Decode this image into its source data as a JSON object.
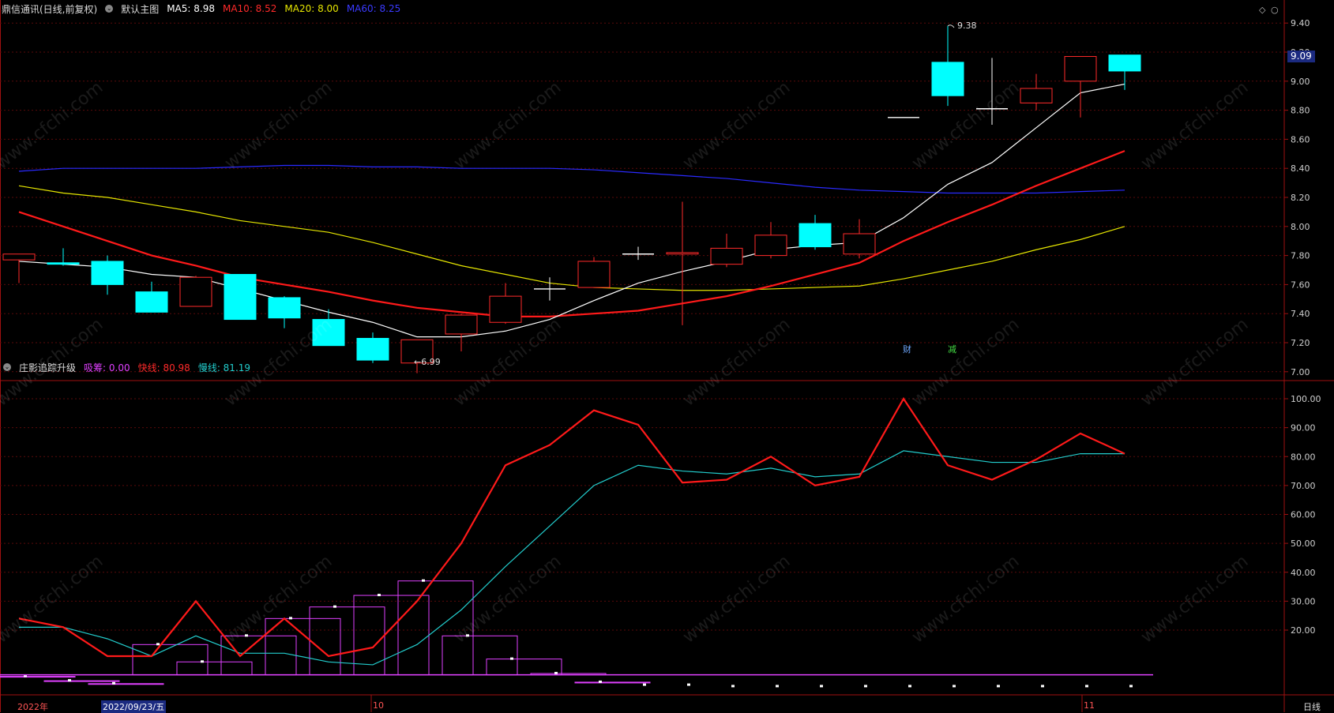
{
  "header_main": {
    "stock": "鼎信通讯(日线,前复权)",
    "chart_name": "默认主图",
    "ma5_label": "MA5: 8.98",
    "ma10_label": "MA10: 8.52",
    "ma20_label": "MA20: 8.00",
    "ma60_label": "MA60: 8.25"
  },
  "header_sub": {
    "indicator": "庄影追踪升级",
    "xichou_label": "吸筹: 0.00",
    "fast_label": "快线: 80.98",
    "slow_label": "慢线: 81.19"
  },
  "price_tag": "9.09",
  "annotations": {
    "high": "9.38",
    "low": "6.99",
    "low_arrow": "←6.99"
  },
  "events": {
    "cai": "财",
    "jian": "减"
  },
  "x_labels": {
    "year": "2022年",
    "date": "2022/09/23/五",
    "oct": "10",
    "nov": "11",
    "period": "日线"
  },
  "watermark": "www.cfchi.com",
  "colors": {
    "up": "#ff2a2a",
    "down": "#00ffff",
    "ma5": "#ffffff",
    "ma10": "#ff1a1a",
    "ma20": "#e6e600",
    "ma60": "#2a2aff",
    "fast": "#ff1a1a",
    "slow": "#22cccc",
    "xichou": "#e040ff"
  },
  "chart_data": [
    {
      "type": "candlestick",
      "title": "鼎信通讯(日线,前复权)",
      "y_ticks": [
        "9.40",
        "9.20",
        "9.00",
        "8.80",
        "8.60",
        "8.40",
        "8.20",
        "8.00",
        "7.80",
        "7.60",
        "7.40",
        "7.20",
        "7.00"
      ],
      "ylim": [
        6.95,
        9.45
      ],
      "candles": [
        {
          "o": 7.77,
          "c": 7.81,
          "h": 7.81,
          "l": 7.61
        },
        {
          "o": 7.75,
          "c": 7.74,
          "h": 7.85,
          "l": 7.73
        },
        {
          "o": 7.76,
          "c": 7.6,
          "h": 7.8,
          "l": 7.53
        },
        {
          "o": 7.55,
          "c": 7.41,
          "h": 7.62,
          "l": 7.41
        },
        {
          "o": 7.45,
          "c": 7.65,
          "h": 7.66,
          "l": 7.45
        },
        {
          "o": 7.67,
          "c": 7.36,
          "h": 7.67,
          "l": 7.36
        },
        {
          "o": 7.51,
          "c": 7.37,
          "h": 7.52,
          "l": 7.3
        },
        {
          "o": 7.36,
          "c": 7.18,
          "h": 7.43,
          "l": 7.18
        },
        {
          "o": 7.23,
          "c": 7.08,
          "h": 7.27,
          "l": 7.06
        },
        {
          "o": 7.06,
          "c": 7.22,
          "h": 7.22,
          "l": 6.99
        },
        {
          "o": 7.26,
          "c": 7.39,
          "h": 7.4,
          "l": 7.14
        },
        {
          "o": 7.34,
          "c": 7.52,
          "h": 7.61,
          "l": 7.33
        },
        {
          "o": 7.57,
          "c": 7.57,
          "h": 7.65,
          "l": 7.49
        },
        {
          "o": 7.58,
          "c": 7.76,
          "h": 7.79,
          "l": 7.58
        },
        {
          "o": 7.81,
          "c": 7.81,
          "h": 7.86,
          "l": 7.77
        },
        {
          "o": 7.81,
          "c": 7.82,
          "h": 8.17,
          "l": 7.32
        },
        {
          "o": 7.74,
          "c": 7.85,
          "h": 7.95,
          "l": 7.72
        },
        {
          "o": 7.8,
          "c": 7.94,
          "h": 8.03,
          "l": 7.78
        },
        {
          "o": 8.02,
          "c": 7.86,
          "h": 8.08,
          "l": 7.84
        },
        {
          "o": 7.81,
          "c": 7.95,
          "h": 8.05,
          "l": 7.78
        },
        {
          "o": 8.75,
          "c": 8.75,
          "h": 8.75,
          "l": 8.75
        },
        {
          "o": 9.13,
          "c": 8.9,
          "h": 9.38,
          "l": 8.83
        },
        {
          "o": 8.81,
          "c": 8.81,
          "h": 9.16,
          "l": 8.7
        },
        {
          "o": 8.85,
          "c": 8.95,
          "h": 9.05,
          "l": 8.8
        },
        {
          "o": 9.0,
          "c": 9.17,
          "h": 9.17,
          "l": 8.75
        },
        {
          "o": 9.18,
          "c": 9.07,
          "h": 9.18,
          "l": 8.94
        }
      ],
      "series": [
        {
          "name": "MA5",
          "values": [
            7.76,
            7.74,
            7.72,
            7.67,
            7.65,
            7.57,
            7.49,
            7.41,
            7.34,
            7.24,
            7.24,
            7.28,
            7.36,
            7.49,
            7.61,
            7.69,
            7.76,
            7.84,
            7.87,
            7.89,
            8.06,
            8.29,
            8.44,
            8.68,
            8.92,
            8.98
          ]
        },
        {
          "name": "MA10",
          "values": [
            8.1,
            8.0,
            7.9,
            7.8,
            7.73,
            7.65,
            7.6,
            7.55,
            7.49,
            7.44,
            7.41,
            7.38,
            7.38,
            7.4,
            7.42,
            7.47,
            7.52,
            7.59,
            7.67,
            7.75,
            7.9,
            8.03,
            8.15,
            8.28,
            8.4,
            8.52
          ]
        },
        {
          "name": "MA20",
          "values": [
            8.28,
            8.23,
            8.2,
            8.15,
            8.1,
            8.04,
            8.0,
            7.96,
            7.89,
            7.81,
            7.73,
            7.67,
            7.61,
            7.58,
            7.57,
            7.56,
            7.56,
            7.57,
            7.58,
            7.59,
            7.64,
            7.7,
            7.76,
            7.84,
            7.91,
            8.0
          ]
        },
        {
          "name": "MA60",
          "values": [
            8.38,
            8.4,
            8.4,
            8.4,
            8.4,
            8.41,
            8.42,
            8.42,
            8.41,
            8.41,
            8.4,
            8.4,
            8.4,
            8.39,
            8.37,
            8.35,
            8.33,
            8.3,
            8.27,
            8.25,
            8.24,
            8.23,
            8.23,
            8.23,
            8.24,
            8.25
          ]
        }
      ]
    },
    {
      "type": "line",
      "title": "庄影追踪升级",
      "y_ticks": [
        "100.00",
        "90.00",
        "80.00",
        "70.00",
        "60.00",
        "50.00",
        "40.00",
        "30.00",
        "20.00"
      ],
      "ylim": [
        10,
        100
      ],
      "series": [
        {
          "name": "快线",
          "values": [
            24,
            21,
            11,
            11,
            30,
            11,
            24,
            11,
            14,
            30,
            50,
            77,
            84,
            96,
            91,
            71,
            72,
            80,
            70,
            73,
            100,
            77,
            72,
            79,
            88,
            81
          ]
        },
        {
          "name": "慢线",
          "values": [
            21,
            21,
            17,
            11,
            18,
            12,
            12,
            9,
            8,
            15,
            27,
            42,
            56,
            70,
            77,
            75,
            74,
            76,
            73,
            74,
            82,
            80,
            78,
            78,
            81,
            81
          ]
        },
        {
          "name": "吸筹",
          "values": [
            4,
            2.5,
            1.5,
            15,
            9,
            18,
            24,
            28,
            32,
            37,
            18,
            10,
            5,
            2,
            1,
            1,
            0.5,
            0.5,
            0.5,
            0.5,
            0.5,
            0.5,
            0.5,
            0.5,
            0.5,
            0.5
          ]
        }
      ]
    }
  ]
}
